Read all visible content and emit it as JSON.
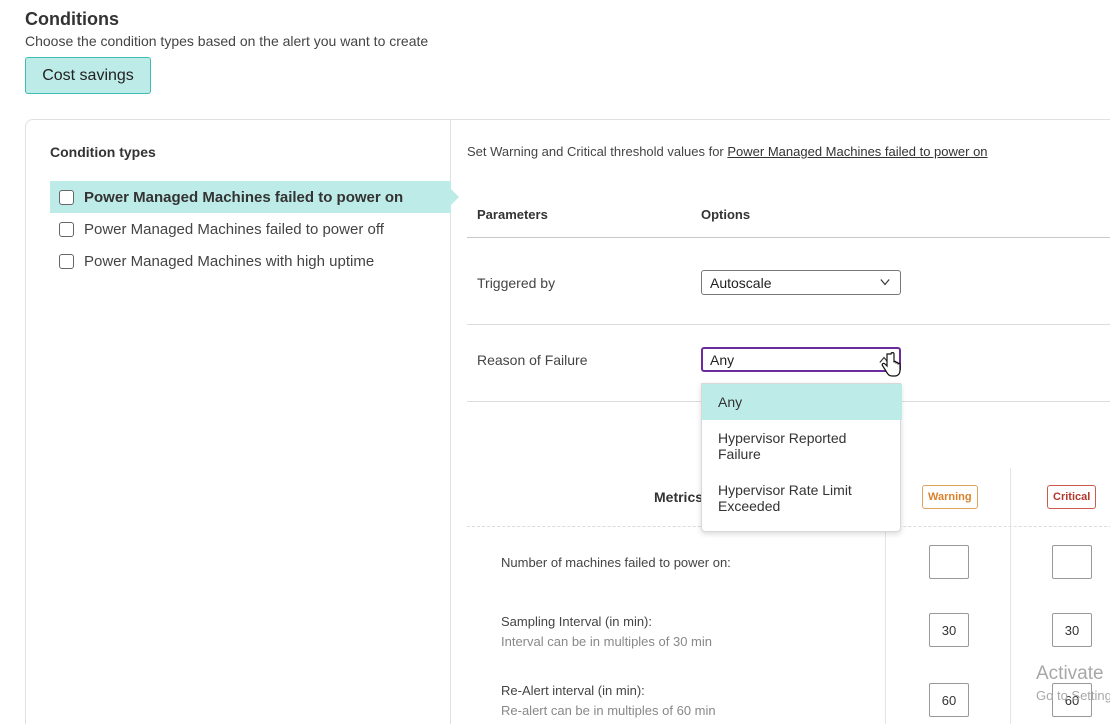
{
  "header": {
    "title": "Conditions",
    "subtitle": "Choose the condition types based on the alert you want to create",
    "category_button": "Cost savings"
  },
  "condition_types": {
    "heading": "Condition types",
    "items": [
      {
        "label": "Power Managed Machines failed to power on",
        "checked": false
      },
      {
        "label": "Power Managed Machines failed to power off",
        "checked": false
      },
      {
        "label": "Power Managed Machines with high uptime",
        "checked": false
      }
    ]
  },
  "thresholds": {
    "intro": "Set Warning and Critical threshold values for ",
    "intro_link": "Power Managed Machines failed to power on",
    "col_parameters": "Parameters",
    "col_options": "Options",
    "triggered_by": {
      "label": "Triggered by",
      "value": "Autoscale"
    },
    "reason_of_failure": {
      "label": "Reason of Failure",
      "value": "Any",
      "options": [
        "Any",
        "Hypervisor Reported Failure",
        "Hypervisor Rate Limit Exceeded"
      ]
    },
    "metrics_label": "Metrics",
    "warning_label": "Warning",
    "critical_label": "Critical",
    "metrics": [
      {
        "label": "Number of machines failed to power on:",
        "hint": "",
        "warning": "",
        "critical": ""
      },
      {
        "label": "Sampling Interval (in min):",
        "hint": "Interval can be in multiples of 30 min",
        "warning": "30",
        "critical": "30"
      },
      {
        "label": "Re-Alert interval (in min):",
        "hint": "Re-alert can be in multiples of 60 min",
        "warning": "60",
        "critical": "60"
      }
    ]
  },
  "watermark": {
    "title": "Activate",
    "subtitle": "Go to Settings"
  },
  "colors": {
    "accent_teal": "#bdebe8",
    "focus_purple": "#6b2d9b",
    "warning": "#d9822b",
    "critical": "#b3372a"
  }
}
